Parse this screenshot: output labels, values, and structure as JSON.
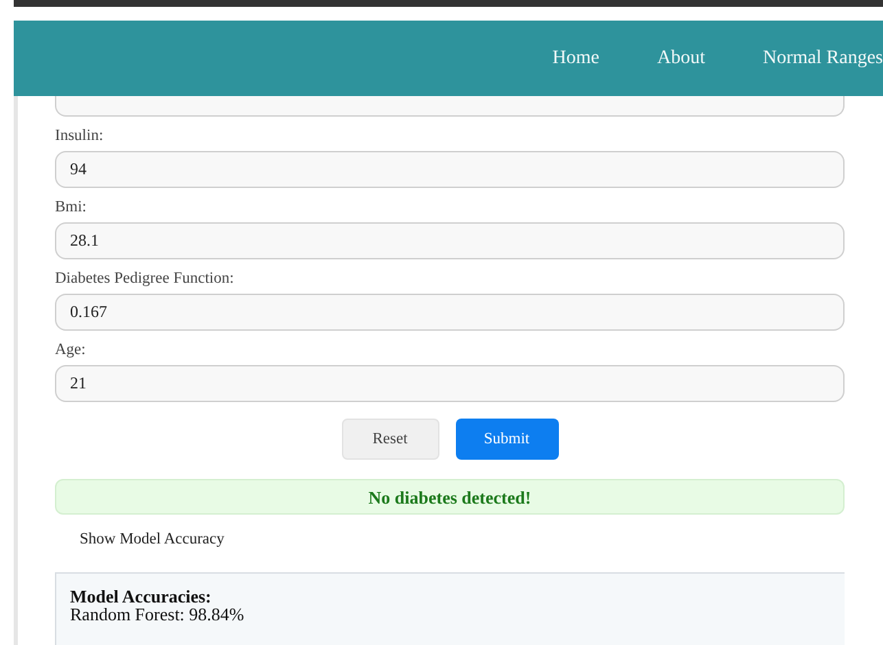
{
  "navbar": {
    "links": [
      "Home",
      "About",
      "Normal Ranges"
    ]
  },
  "fields": [
    {
      "label": "Insulin:",
      "value": "94"
    },
    {
      "label": "Bmi:",
      "value": "28.1"
    },
    {
      "label": "Diabetes Pedigree Function:",
      "value": "0.167"
    },
    {
      "label": "Age:",
      "value": "21"
    }
  ],
  "buttons": [
    {
      "label": "Reset",
      "kind": "secondary"
    },
    {
      "label": "Submit",
      "kind": "primary"
    }
  ],
  "result": {
    "message": "No diabetes detected!"
  },
  "accuracy_toggle": "Show Model Accuracy",
  "accuracies": {
    "heading": "Model Accuracies:",
    "lines": [
      "Random Forest: 98.84%"
    ]
  }
}
